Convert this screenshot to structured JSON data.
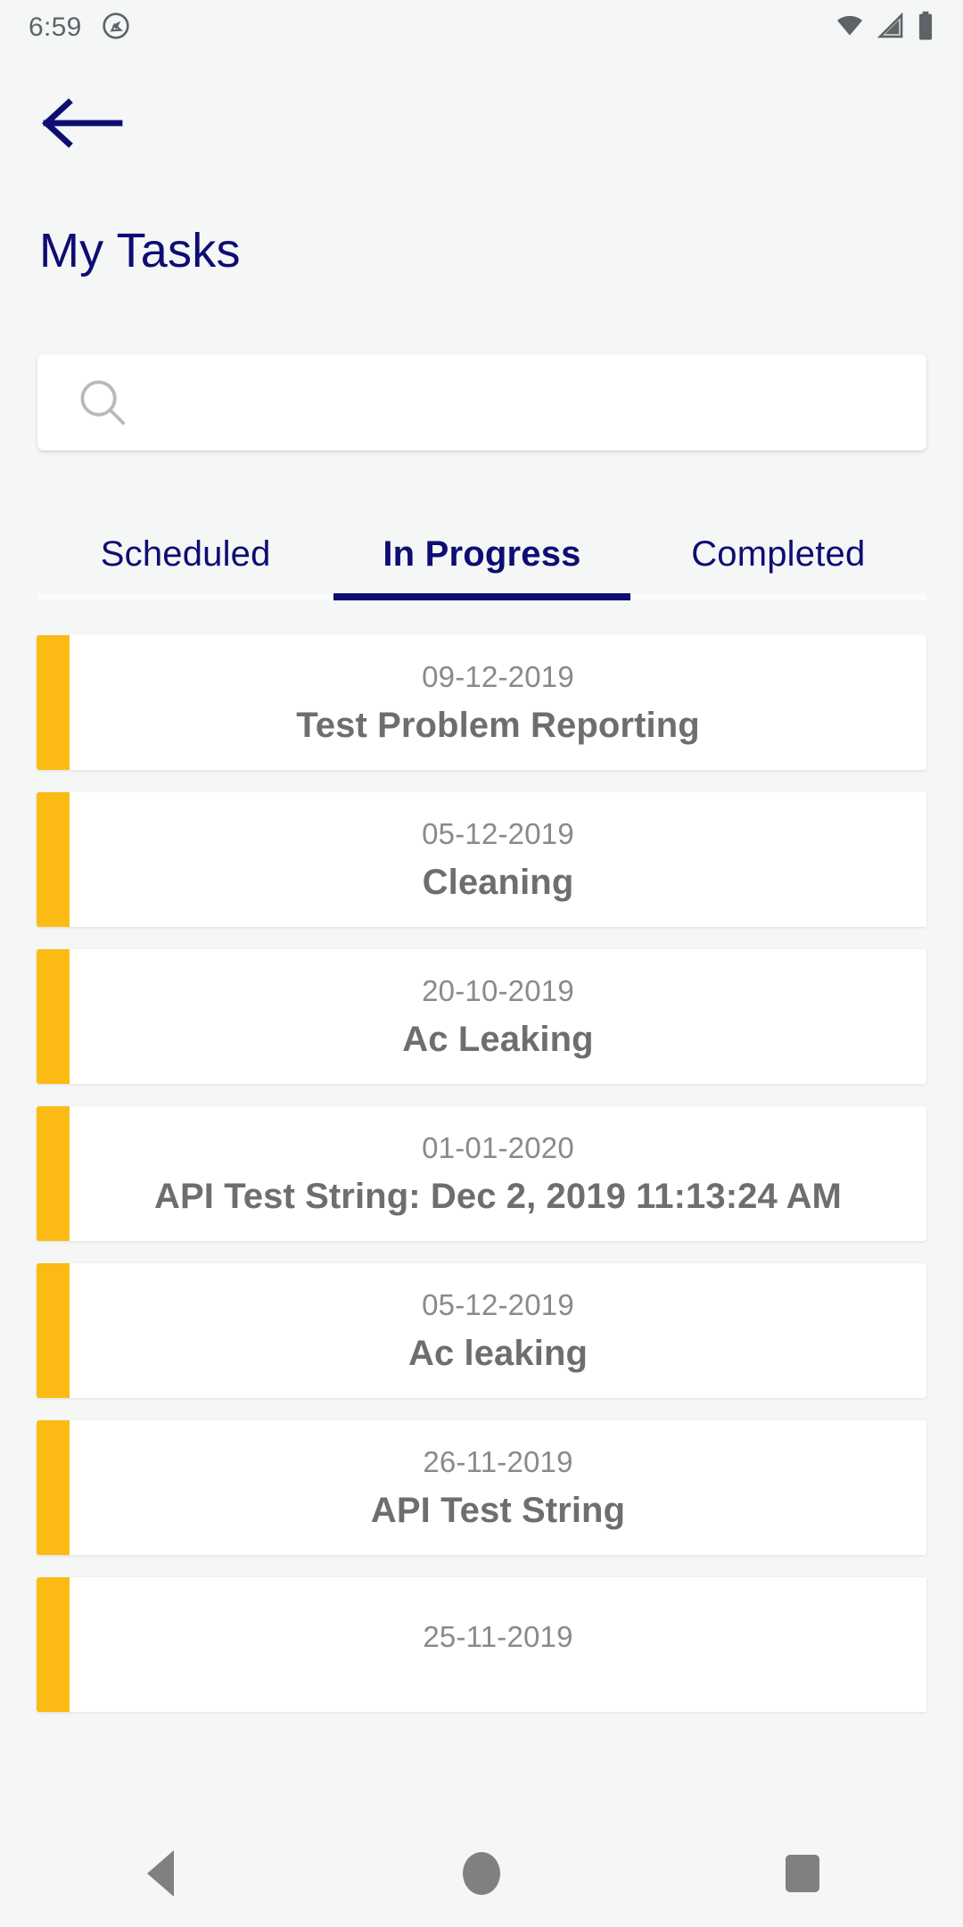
{
  "status_bar": {
    "time": "6:59",
    "icons": [
      "screen-record-icon",
      "wifi-icon",
      "cellular-signal-icon",
      "battery-icon"
    ],
    "icon_color": "#5f6368"
  },
  "header": {
    "back_label": "back-arrow",
    "title": "My Tasks",
    "title_color": "#0d0d73"
  },
  "search": {
    "value": "",
    "placeholder": "",
    "icon": "search-icon"
  },
  "tabs": {
    "items": [
      {
        "label": "Scheduled",
        "active": false
      },
      {
        "label": "In Progress",
        "active": true
      },
      {
        "label": "Completed",
        "active": false
      }
    ],
    "active_index": 1,
    "indicator_color": "#0d0d73"
  },
  "tasks": {
    "accent_color": "#fcbb14",
    "items": [
      {
        "date": "09-12-2019",
        "title": "Test Problem Reporting"
      },
      {
        "date": "05-12-2019",
        "title": "Cleaning"
      },
      {
        "date": "20-10-2019",
        "title": "Ac Leaking"
      },
      {
        "date": "01-01-2020",
        "title": "API Test String: Dec 2, 2019 11:13:24 AM"
      },
      {
        "date": "05-12-2019",
        "title": "Ac leaking"
      },
      {
        "date": "26-11-2019",
        "title": "API Test String"
      },
      {
        "date": "25-11-2019",
        "title": ""
      }
    ]
  },
  "nav_bar": {
    "buttons": [
      "back-nav-button",
      "home-nav-button",
      "recents-nav-button"
    ],
    "color": "#808080"
  }
}
